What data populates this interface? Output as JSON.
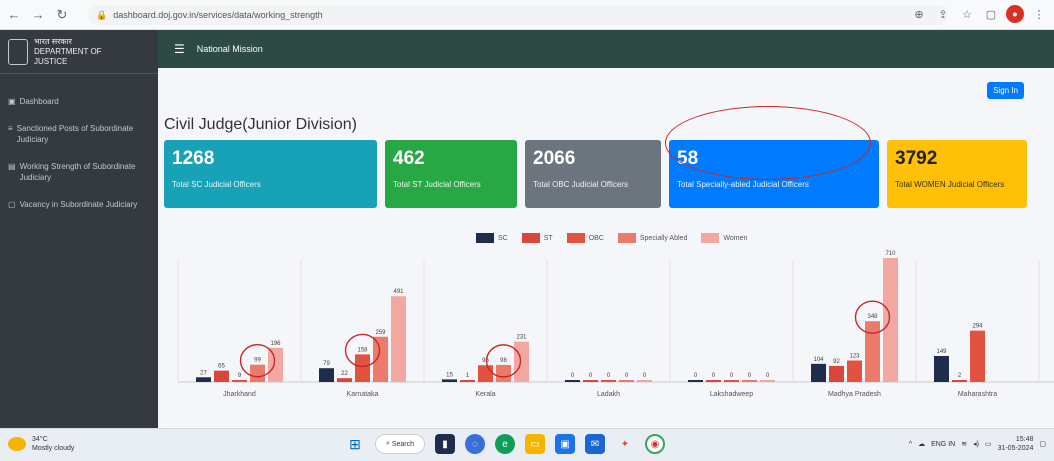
{
  "browser": {
    "url": "dashboard.doj.gov.in/services/data/working_strength",
    "back_icon": "back-arrow-icon",
    "refresh_symbol": "C"
  },
  "sidebar": {
    "brand_line1": "भारत सरकार",
    "brand_line2": "DEPARTMENT OF",
    "brand_line3": "JUSTICE",
    "items": [
      {
        "label": "Dashboard",
        "icon": "dashboard-icon"
      },
      {
        "label": "Sanctioned Posts of Subordinate Judiciary",
        "icon": "list-icon"
      },
      {
        "label": "Working Strength of Subordinate Judiciary",
        "icon": "chart-icon"
      },
      {
        "label": "Vacancy in Subordinate Judiciary",
        "icon": "doc-icon"
      }
    ]
  },
  "navbar": {
    "title": "National Mission"
  },
  "signin_label": "Sign In",
  "page_title": "Civil Judge(Junior Division)",
  "cards": [
    {
      "value": "1268",
      "label": "Total SC Judicial Officers",
      "color": "#17a2b8"
    },
    {
      "value": "462",
      "label": "Total ST Judicial Officers",
      "color": "#28a745"
    },
    {
      "value": "2066",
      "label": "Total OBC Judicial Officers",
      "color": "#6c757d"
    },
    {
      "value": "58",
      "label": "Total Specially-abled Judicial Officers",
      "color": "#007bff"
    },
    {
      "value": "3792",
      "label": "Total WOMEN Judicial Officers",
      "color": "#ffc107"
    }
  ],
  "chart_data": {
    "type": "bar",
    "categories": [
      "Jharkhand",
      "Karnataka",
      "Kerala",
      "Ladakh",
      "Lakshadweep",
      "Madhya Pradesh",
      "Maharashtra"
    ],
    "series": [
      {
        "name": "SC",
        "color": "#1f2d4d",
        "values": [
          27,
          79,
          15,
          0,
          0,
          104,
          149
        ]
      },
      {
        "name": "ST",
        "color": "#d9463a",
        "values": [
          65,
          22,
          1,
          0,
          0,
          92,
          2
        ]
      },
      {
        "name": "OBC",
        "color": "#e2533f",
        "values": [
          9,
          158,
          96,
          0,
          0,
          123,
          294
        ]
      },
      {
        "name": "Specially Abled",
        "color": "#ec7a6a",
        "values": [
          99,
          259,
          98,
          0,
          0,
          348,
          null
        ]
      },
      {
        "name": "Women",
        "color": "#f2a7a0",
        "values": [
          196,
          491,
          231,
          0,
          0,
          710,
          null
        ]
      }
    ],
    "ylim": [
      0,
      710
    ],
    "legend_position": "top-center",
    "grid": "vertical"
  },
  "taskbar": {
    "weather_temp": "34°C",
    "weather_desc": "Mostly cloudy",
    "search_label": "Search",
    "time": "15:48",
    "date": "31-05-2024",
    "lang": "ENG IN"
  }
}
